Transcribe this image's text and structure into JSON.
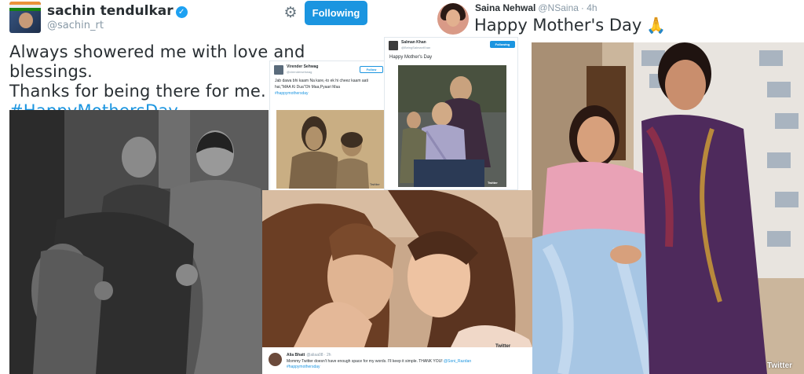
{
  "sachin": {
    "name": "sachin tendulkar",
    "handle": "@sachin_rt",
    "follow_label": "Following",
    "text_line1": "Always showered me with love and blessings.",
    "text_line2": "Thanks for being there for me.",
    "hashtag": "#HappyMothersDay"
  },
  "saina": {
    "name": "Saina Nehwal",
    "handle": "@NSaina",
    "time": "· 4h",
    "text": "Happy Mother's Day",
    "emoji": "🙏",
    "watermark": "Twitter"
  },
  "sehwag": {
    "name": "Virender Sehwag",
    "handle": "@virendersehwag",
    "follow_label": "Follow",
    "text": "Jab dawa bhi kaam Na kare,-to ek hi cheez kaam aati hai,\"MAA Ki Dua\"Oh Maa,Pyaari Maa",
    "hashtag": "#happymothersday",
    "watermark": "Twitter"
  },
  "salman": {
    "name": "Salman Khan",
    "handle": "@BeingSalmanKhan",
    "follow_label": "Following",
    "text": "Happy Mother's Day",
    "watermark": "Twitter"
  },
  "alia": {
    "name": "Alia Bhatt",
    "handle": "@aliaa08 · 2h",
    "text": "Mommy Twitter doesn't have enough space for my words. I'll keep it simple. THANK YOU!",
    "mention": "@Soni_Razdan",
    "hashtag": "#happymothersday",
    "watermark": "Twitter"
  },
  "colors": {
    "accent": "#1b95e0",
    "text": "#292f33",
    "muted": "#8899a6"
  }
}
